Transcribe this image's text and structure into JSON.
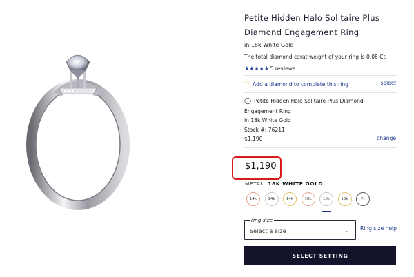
{
  "product": {
    "title": "Petite Hidden Halo Solitaire Plus Diamond Engagement Ring",
    "metal": "in 18k White Gold",
    "carat_note": "The total diamond carat weight of your ring is 0.08 Ct.",
    "rating": 5,
    "stars": "★★★★★",
    "reviews_label": "5 reviews"
  },
  "add_diamond": {
    "label": "Add a diamond to complete this ring",
    "select_label": "select",
    "icon": "heart-icon"
  },
  "summary": {
    "name": "Petite Hidden Halo Solitaire Plus Diamond Engagement Ring",
    "metal": "in 18k White Gold",
    "stock": "Stock #: 76211",
    "price": "$1,190",
    "change_label": "change",
    "icon": "ring-icon"
  },
  "price": "$1,190",
  "metal_selector": {
    "label": "METAL:",
    "selected": "18K WHITE GOLD",
    "options": [
      {
        "label": "14k",
        "color": "#e3a38f"
      },
      {
        "label": "14k",
        "color": "#c8c8c8"
      },
      {
        "label": "14k",
        "color": "#e6c36a"
      },
      {
        "label": "18k",
        "color": "#e3a38f"
      },
      {
        "label": "18k",
        "color": "#c8c8c8"
      },
      {
        "label": "18k",
        "color": "#e6c36a"
      },
      {
        "label": "Pt",
        "color": "#5a5a5a"
      }
    ],
    "selected_index": 4
  },
  "ring_size": {
    "label": "ring size",
    "placeholder": "Select a size",
    "help_label": "Ring size help"
  },
  "cta": {
    "label": "SELECT SETTING"
  },
  "colors": {
    "accent": "#1f3b8f",
    "button_bg": "#13142c",
    "highlight": "#d71a1a",
    "star": "#1f3f9e"
  }
}
